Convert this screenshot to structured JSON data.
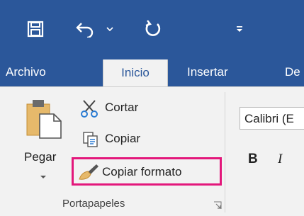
{
  "quick_access": {
    "save_icon": "save-icon",
    "undo_icon": "undo-icon",
    "undo_dropdown_icon": "chevron-down-icon",
    "redo_icon": "redo-icon",
    "customize_icon": "customize-qat-icon"
  },
  "tabs": [
    {
      "label": "Archivo",
      "active": false
    },
    {
      "label": "Inicio",
      "active": true
    },
    {
      "label": "Insertar",
      "active": false
    },
    {
      "label": "De",
      "active": false
    }
  ],
  "clipboard": {
    "paste_label": "Pegar",
    "cut_label": "Cortar",
    "copy_label": "Copiar",
    "format_painter_label": "Copiar formato",
    "group_label": "Portapapeles"
  },
  "font": {
    "font_name": "Calibri (E",
    "bold_label": "B",
    "italic_label": "I"
  },
  "colors": {
    "accent": "#2b579a",
    "highlight": "#e3177b"
  }
}
